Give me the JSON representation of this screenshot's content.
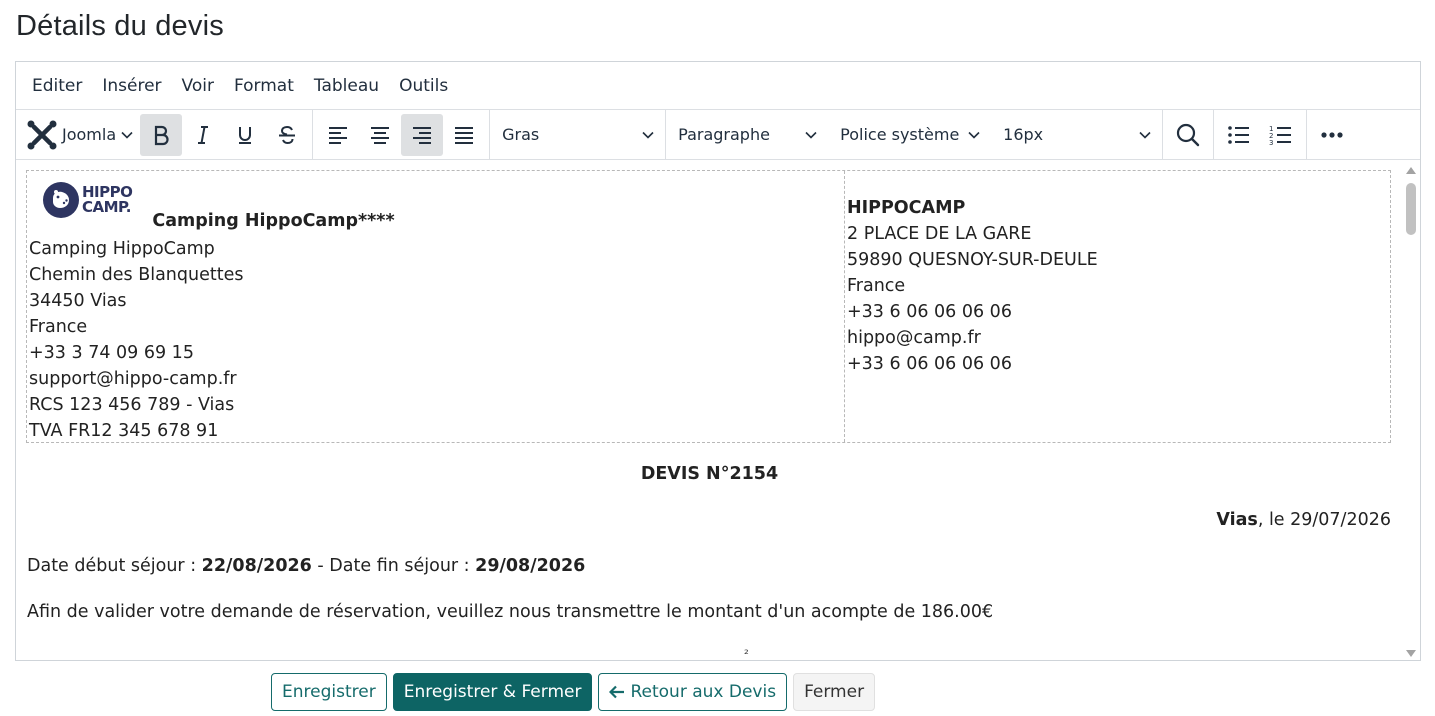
{
  "page": {
    "title": "Détails du devis"
  },
  "menubar": [
    "Editer",
    "Insérer",
    "Voir",
    "Format",
    "Tableau",
    "Outils"
  ],
  "toolbar": {
    "joomla_label": "Joomla",
    "style_select": "Gras",
    "block_select": "Paragraphe",
    "font_select": "Police système",
    "size_select": "16px"
  },
  "document": {
    "logo_text_line1": "HIPPO",
    "logo_text_line2": "CAMP.",
    "camping_name": "Camping HippoCamp****",
    "sender_lines": [
      "Camping HippoCamp",
      "Chemin des Blanquettes",
      "34450 Vias",
      "France",
      "+33 3 74 09 69 15",
      "support@hippo-camp.fr",
      "RCS 123 456 789 - Vias",
      "TVA FR12 345 678 91"
    ],
    "recipient_name": "HIPPOCAMP",
    "recipient_lines": [
      "2 PLACE DE LA GARE",
      "59890 QUESNOY-SUR-DEULE",
      "France",
      "+33 6 06 06 06 06",
      "hippo@camp.fr",
      "+33 6 06 06 06 06"
    ],
    "devis_number": "DEVIS N°2154",
    "city": "Vias",
    "date_suffix": ", le 29/07/2026",
    "start_label": "Date début séjour : ",
    "start_date": "22/08/2026",
    "end_label": " - Date fin séjour : ",
    "end_date": "29/08/2026",
    "deposit_text": "Afin de valider votre demande de réservation, veuillez nous transmettre le montant d'un acompte de 186.00€",
    "cut_text": "²"
  },
  "actions": {
    "save": "Enregistrer",
    "save_close": "Enregistrer & Fermer",
    "back": "Retour aux Devis",
    "close": "Fermer"
  },
  "colors": {
    "primary": "#0d6464",
    "toolbar_active": "#dee0e2",
    "logo": "#2e3561"
  }
}
